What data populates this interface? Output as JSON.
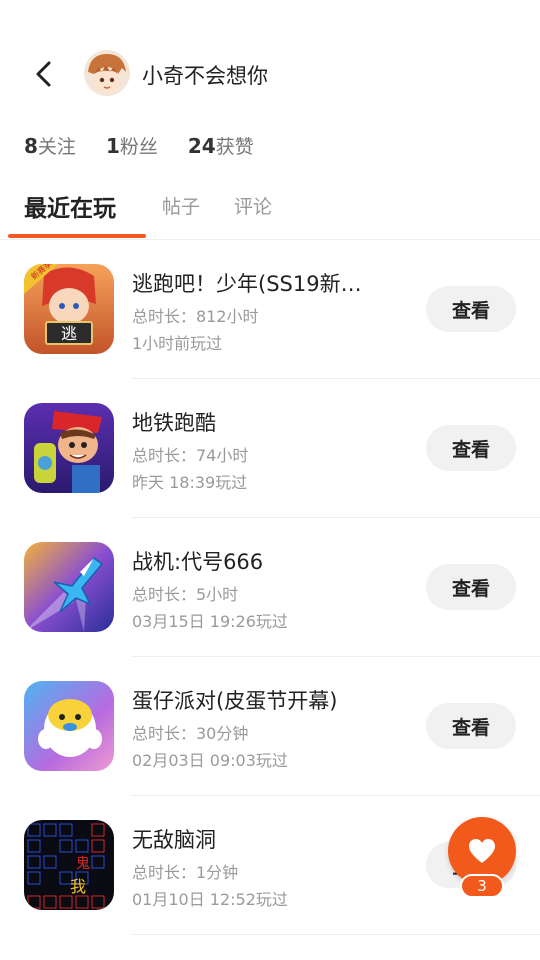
{
  "header": {
    "username": "小奇不会想你",
    "avatar_icon": "anime-boy-avatar"
  },
  "stats": [
    {
      "count": "8",
      "label": "关注"
    },
    {
      "count": "1",
      "label": "粉丝"
    },
    {
      "count": "24",
      "label": "获赞"
    }
  ],
  "tabs": [
    {
      "label": "最近在玩",
      "active": true
    },
    {
      "label": "帖子",
      "active": false
    },
    {
      "label": "评论",
      "active": false
    }
  ],
  "games": [
    {
      "title": "逃跑吧！少年(SS19新…",
      "duration": "总时长：812小时",
      "last_played": "1小时前玩过",
      "button": "查看",
      "icon": "escape-game-icon"
    },
    {
      "title": "地铁跑酷",
      "duration": "总时长：74小时",
      "last_played": "昨天 18:39玩过",
      "button": "查看",
      "icon": "subway-surfers-icon"
    },
    {
      "title": "战机:代号666",
      "duration": "总时长：5小时",
      "last_played": "03月15日 19:26玩过",
      "button": "查看",
      "icon": "fighter-jet-icon"
    },
    {
      "title": "蛋仔派对(皮蛋节开幕)",
      "duration": "总时长：30分钟",
      "last_played": "02月03日 09:03玩过",
      "button": "查看",
      "icon": "eggy-party-icon"
    },
    {
      "title": "无敌脑洞",
      "duration": "总时长：1分钟",
      "last_played": "01月10日 12:52玩过",
      "button": "查看",
      "icon": "brain-hole-icon"
    }
  ],
  "like_fab": {
    "count": "3"
  },
  "colors": {
    "accent": "#f25a1c",
    "tab_indicator": "#f05a1e"
  }
}
